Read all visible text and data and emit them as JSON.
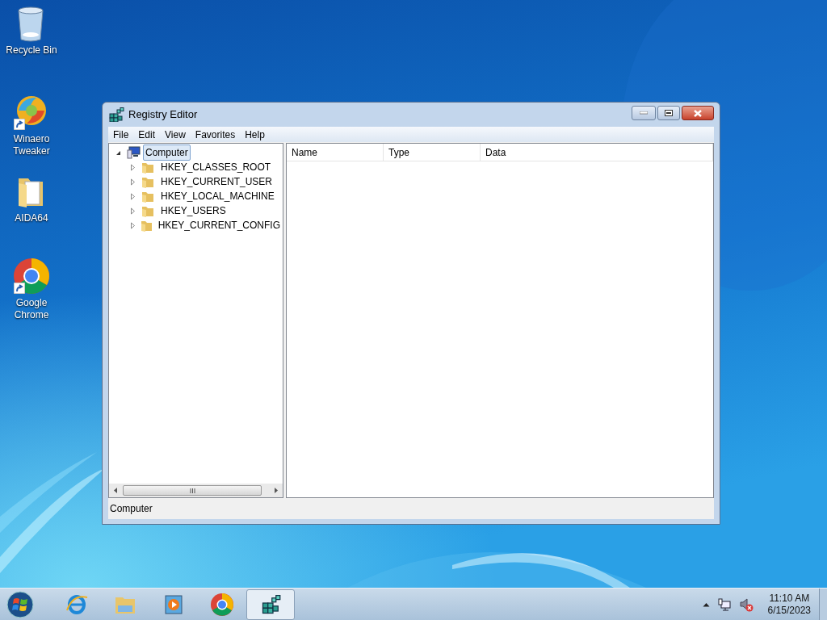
{
  "desktop_icons": [
    {
      "label": "Recycle Bin",
      "kind": "bin",
      "shortcut": false
    },
    {
      "label": "Winaero Tweaker",
      "kind": "swirl",
      "shortcut": true
    },
    {
      "label": "AIDA64",
      "kind": "folder",
      "shortcut": false
    },
    {
      "label": "Google Chrome",
      "kind": "chrome",
      "shortcut": true
    }
  ],
  "window": {
    "title": "Registry Editor",
    "menu": [
      "File",
      "Edit",
      "View",
      "Favorites",
      "Help"
    ],
    "tree": [
      {
        "label": "Computer",
        "expanded": true,
        "selected": true,
        "children": [
          {
            "label": "HKEY_CLASSES_ROOT",
            "expanded": false,
            "selected": false
          },
          {
            "label": "HKEY_CURRENT_USER",
            "expanded": false,
            "selected": false
          },
          {
            "label": "HKEY_LOCAL_MACHINE",
            "expanded": false,
            "selected": false
          },
          {
            "label": "HKEY_USERS",
            "expanded": false,
            "selected": false
          },
          {
            "label": "HKEY_CURRENT_CONFIG",
            "expanded": false,
            "selected": false
          }
        ]
      }
    ],
    "columns": [
      "Name",
      "Type",
      "Data"
    ],
    "status_bar": "Computer"
  },
  "taskbar": {
    "apps": [
      {
        "kind": "ie",
        "selected": false
      },
      {
        "kind": "explorer",
        "selected": false
      },
      {
        "kind": "media",
        "selected": false
      },
      {
        "kind": "chrome",
        "selected": false
      },
      {
        "kind": "regedit",
        "selected": true
      }
    ],
    "clock": {
      "time": "11:10 AM",
      "date": "6/15/2023"
    }
  }
}
